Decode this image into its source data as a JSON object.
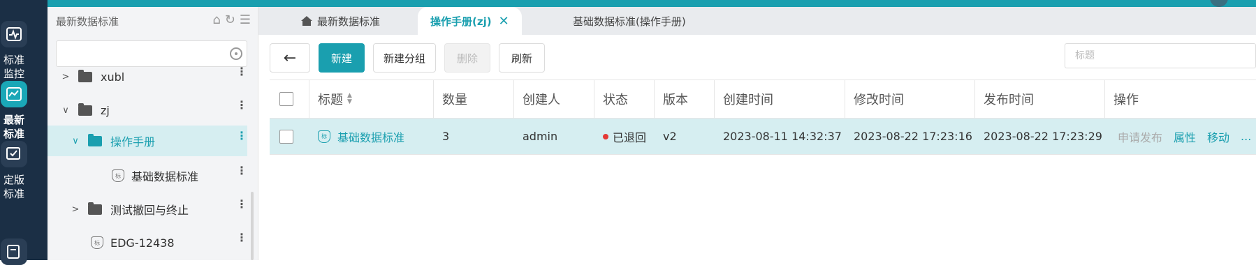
{
  "rail": {
    "items": [
      {
        "label": "标准监控",
        "icon": "heartbeat-monitor-icon"
      },
      {
        "label": "最新标准",
        "icon": "chart-edit-icon"
      },
      {
        "label": "定版标准",
        "icon": "check-document-icon"
      },
      {
        "label": "",
        "icon": "edit-document-icon"
      }
    ]
  },
  "tree": {
    "header": "最新数据标准",
    "search_placeholder": "",
    "nodes": [
      {
        "label": "xubl"
      },
      {
        "label": "zj"
      },
      {
        "label": "操作手册"
      },
      {
        "label": "基础数据标准"
      },
      {
        "label": "测试撤回与终止"
      },
      {
        "label": "EDG-12438"
      }
    ]
  },
  "tabs": [
    {
      "label": "最新数据标准"
    },
    {
      "label": "操作手册(zj)"
    },
    {
      "label": "基础数据标准(操作手册)"
    }
  ],
  "toolbar": {
    "back": "←",
    "new": "新建",
    "new_group": "新建分组",
    "delete": "删除",
    "refresh": "刷新",
    "title_placeholder": "标题"
  },
  "table": {
    "columns": [
      "标题",
      "数量",
      "创建人",
      "状态",
      "版本",
      "创建时间",
      "修改时间",
      "发布时间",
      "操作"
    ],
    "rows": [
      {
        "title": "基础数据标准",
        "count": "3",
        "creator": "admin",
        "status": "已退回",
        "version": "v2",
        "created": "2023-08-11 14:32:37",
        "modified": "2023-08-22 17:23:16",
        "published": "2023-08-22 17:23:29",
        "actions": [
          "申请发布",
          "属性",
          "移动",
          "..."
        ]
      }
    ]
  },
  "colors": {
    "accent": "#1a9faf",
    "rail": "#1b2f45",
    "status_red": "#e53935"
  }
}
